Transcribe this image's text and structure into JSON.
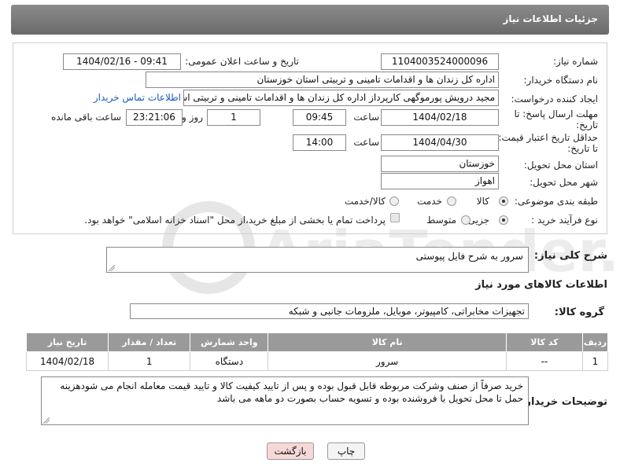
{
  "header": {
    "title": "جزئیات اطلاعات نیاز"
  },
  "watermark": {
    "text": "AriaTender.net"
  },
  "form": {
    "need_number": {
      "label": "شماره نیاز:",
      "value": "1104003524000096"
    },
    "announce_datetime": {
      "label": "تاریخ و ساعت اعلان عمومی:",
      "value": "1404/02/16 - 09:41"
    },
    "buyer_org": {
      "label": "نام دستگاه خریدار:",
      "value": "اداره کل زندان ها و اقدامات تامینی و تربیتی استان خوزستان"
    },
    "requester": {
      "label": "ایجاد کننده درخواست:",
      "value": "مجید درویش پورموگهی کارپرداز اداره کل زندان ها و اقدامات تامینی و تربیتی است",
      "contact_link": "اطلاعات تماس خریدار"
    },
    "reply_deadline": {
      "label_line1": "مهلت ارسال پاسخ: تا",
      "label_line2": "تاریخ:",
      "date": "1404/02/18",
      "time_label": "ساعت",
      "time": "09:45",
      "days": "1",
      "days_label": "روز و",
      "remaining": "23:21:06",
      "remaining_label": "ساعت باقی مانده"
    },
    "price_validity": {
      "label_line1": "حداقل تاریخ اعتبار قیمت:",
      "label_line2": "تا تاریخ:",
      "date": "1404/04/30",
      "time_label": "ساعت",
      "time": "14:00"
    },
    "delivery_province": {
      "label": "استان محل تحویل:",
      "value": "خوزستان"
    },
    "delivery_city": {
      "label": "شهر محل تحویل:",
      "value": "اهواز"
    },
    "category": {
      "label": "طبقه بندی موضوعی:",
      "options": [
        "کالا",
        "خدمت",
        "کالا/خدمت"
      ],
      "selected": "کالا"
    },
    "purchase_type": {
      "label": "نوع فرآیند خرید :",
      "options": [
        "جزیی",
        "متوسط"
      ],
      "selected": "جزیی",
      "note": "پرداخت تمام یا بخشی از مبلغ خرید،از محل \"اسناد خزانه اسلامی\" خواهد بود."
    }
  },
  "general_description": {
    "label": "شرح کلی نیاز:",
    "value": "سرور به شرح فایل پیوستی"
  },
  "items_section": {
    "title": "اطلاعات کالاهای مورد نیاز",
    "group_label": "گروه کالا:",
    "group_value": "تجهیزات مخابراتی، کامپیوتر، موبایل، ملزومات جانبی و شبکه",
    "columns": [
      "ردیف",
      "کد کالا",
      "نام کالا",
      "واحد شمارش",
      "تعداد / مقدار",
      "تاریخ نیاز"
    ],
    "rows": [
      {
        "row": "1",
        "code": "--",
        "name": "سرور",
        "unit": "دستگاه",
        "qty": "1",
        "date": "1404/02/18"
      }
    ]
  },
  "buyer_notes": {
    "label": "توضیحات خریدار:",
    "value": "خرید صرفاً از صنف وشرکت مربوطه قابل قبول بوده و پس از تایید کیفیت کالا و تایید قیمت معامله انجام می شودهزینه حمل تا محل تحویل با فروشنده بوده و تسویه حساب بصورت دو ماهه می باشد"
  },
  "buttons": {
    "print": "چاپ",
    "back": "بازگشت"
  },
  "colors": {
    "header_bg": "#7a7a7a",
    "table_header_bg": "#9a9a9a",
    "link": "#1a5bbf",
    "back_button_bg": "#f7d8d8"
  }
}
